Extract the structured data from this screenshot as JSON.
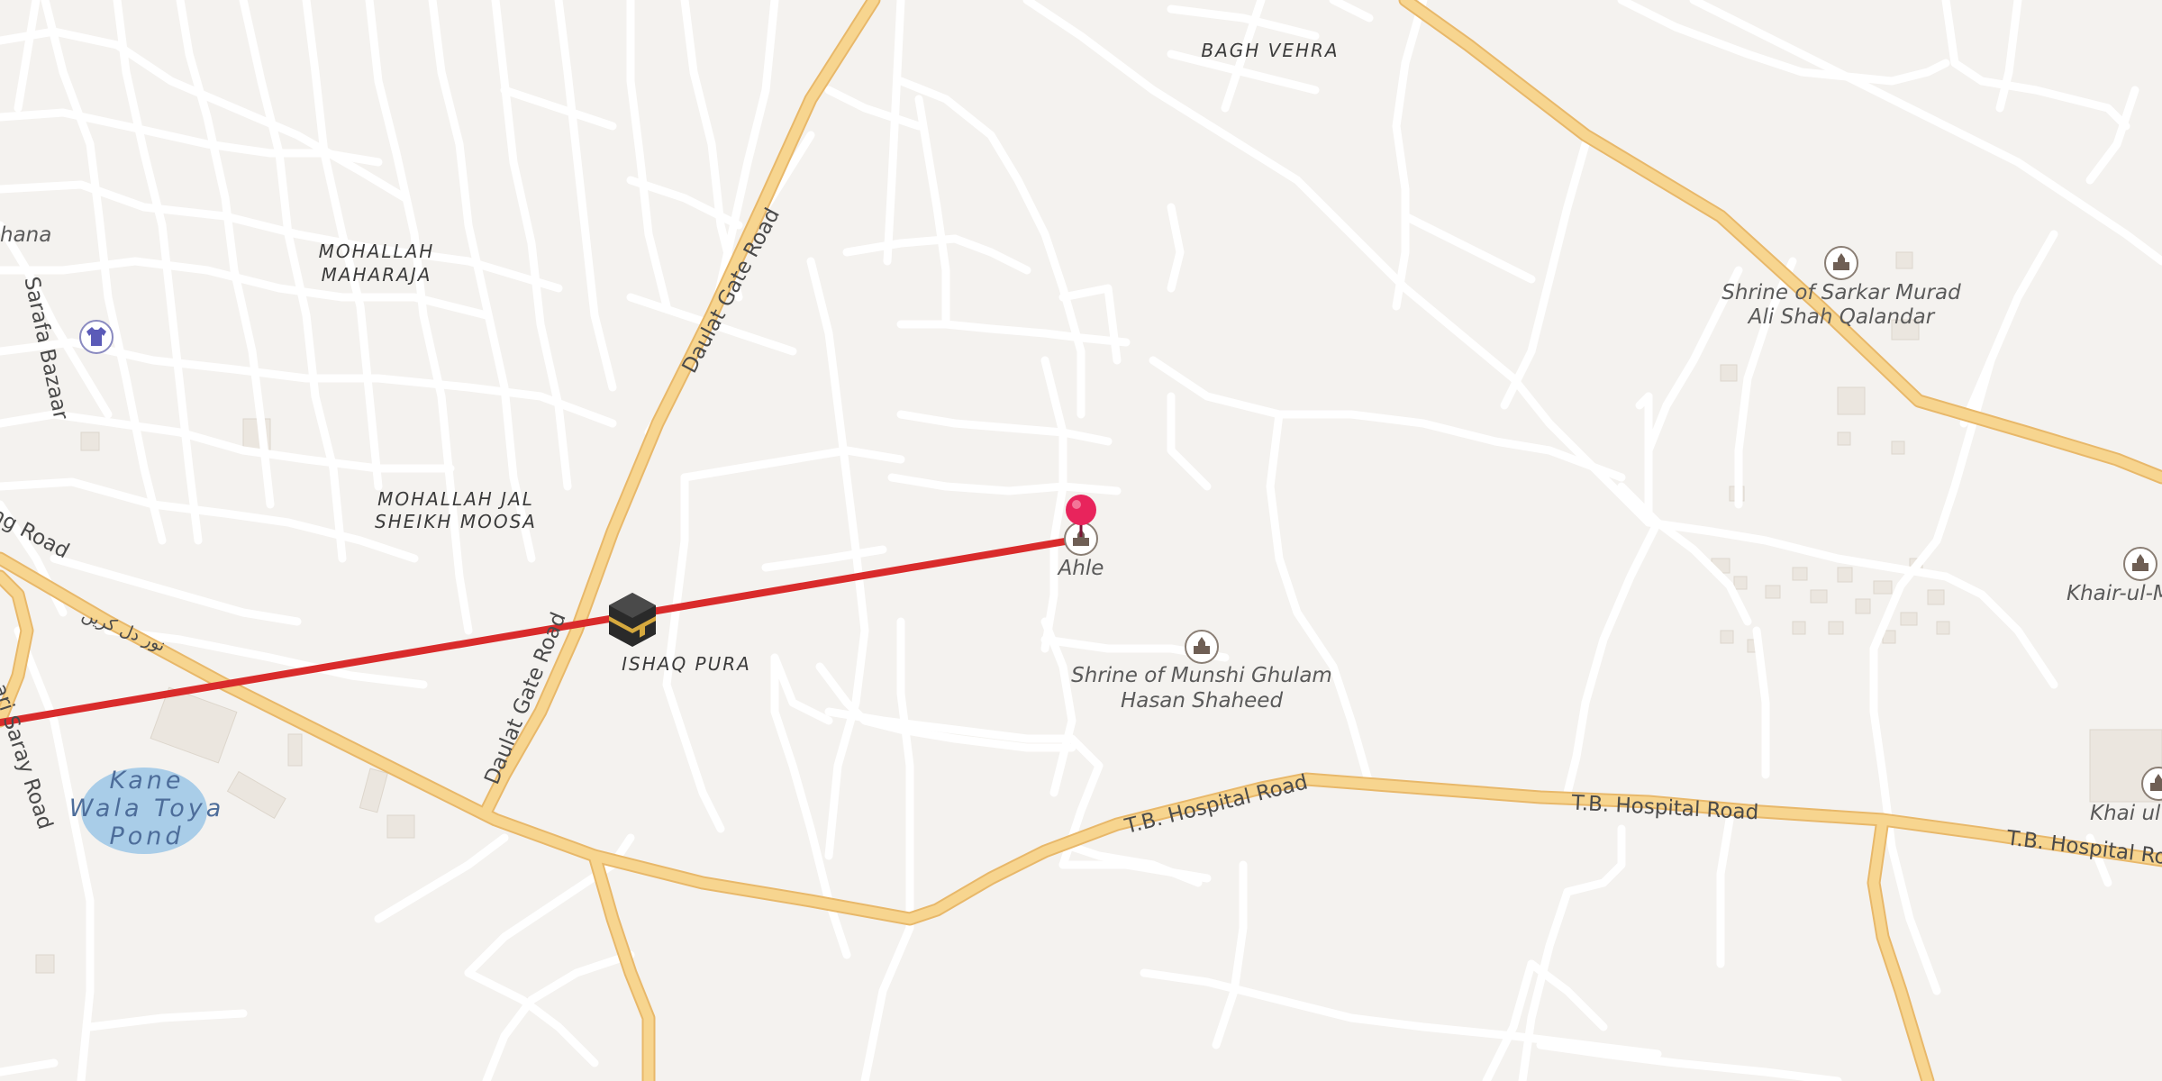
{
  "map": {
    "area_labels": {
      "bagh_vehra": "BAGH VEHRA",
      "mohallah_maharaja_1": "MOHALLAH",
      "mohallah_maharaja_2": "MAHARAJA",
      "mohallah_jal_1": "MOHALLAH JAL",
      "mohallah_jal_2": "SHEIKH MOOSA",
      "ishaq_pura": "ISHAQ PURA",
      "shana_partial": "hana"
    },
    "road_labels": {
      "daulat_gate_upper": "Daulat Gate Road",
      "daulat_gate_lower": "Daulat Gate Road",
      "tb_hospital_1": "T.B. Hospital Road",
      "tb_hospital_2": "T.B. Hospital Road",
      "tb_hospital_3": "T.B. Hospital Road",
      "sarafa_bazaar": "Sarafa Bazaar",
      "left_road_partial": "ng Road",
      "urdu_road": "نور دل کریں",
      "saray_road_partial": "ari Saray Road"
    },
    "poi_labels": {
      "ahle": "Ahle",
      "shrine_sarkar_1": "Shrine of Sarkar Murad",
      "shrine_sarkar_2": "Ali Shah Qalandar",
      "shrine_munshi_1": "Shrine of Munshi Ghulam",
      "shrine_munshi_2": "Hasan Shaheed",
      "khair_partial": "Khair-ul-M",
      "khai_partial": "Khai ul"
    },
    "water_labels": {
      "pond_1": "Kane",
      "pond_2": "Wala Toya",
      "pond_3": "Pond"
    },
    "icons": {
      "location_pin": "map-pin-icon",
      "kaaba": "kaaba-icon",
      "shrine": "shrine-icon",
      "clothes": "clothes-shop-icon"
    },
    "colors": {
      "background": "#f4f2ef",
      "major_road": "#f7d58f",
      "minor_road": "#ffffff",
      "route_line": "#d92b2b",
      "pin": "#e8245c",
      "water": "#a9cde8"
    }
  }
}
